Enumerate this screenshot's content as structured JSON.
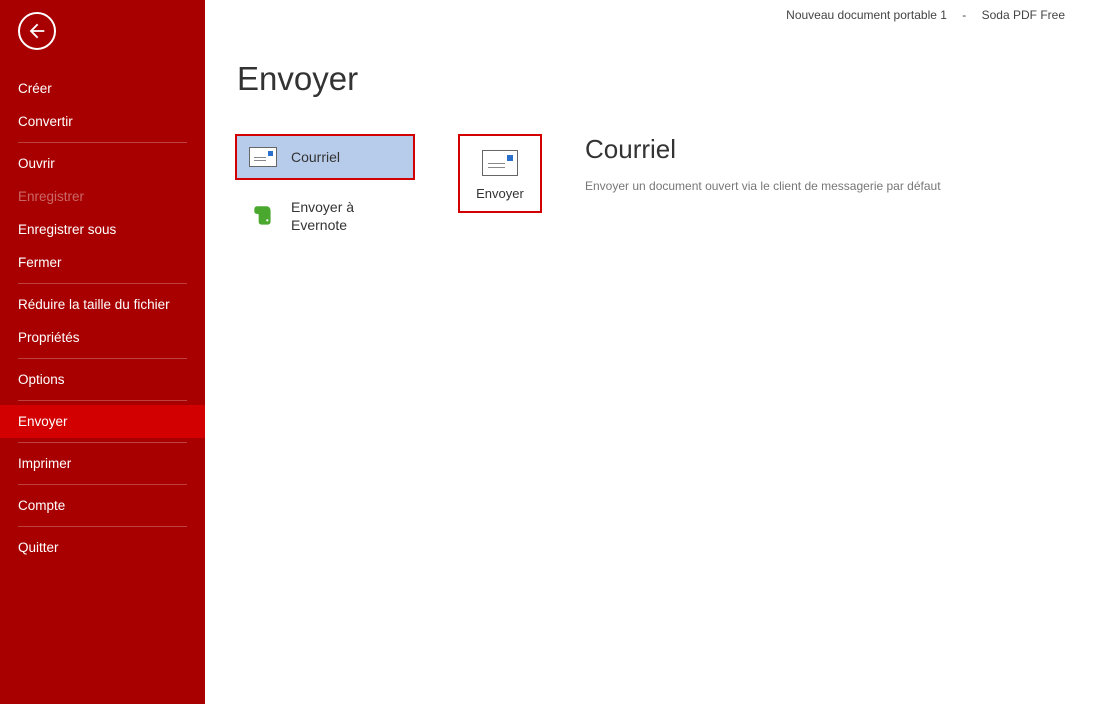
{
  "topbar": {
    "docname": "Nouveau document portable 1",
    "sep": "-",
    "appname": "Soda PDF Free"
  },
  "sidebar": {
    "creer": "Créer",
    "convertir": "Convertir",
    "ouvrir": "Ouvrir",
    "enregistrer": "Enregistrer",
    "enreg_sous": "Enregistrer sous",
    "fermer": "Fermer",
    "reduire": "Réduire la taille du fichier",
    "proprietes": "Propriétés",
    "options": "Options",
    "envoyer": "Envoyer",
    "imprimer": "Imprimer",
    "compte": "Compte",
    "quitter": "Quitter"
  },
  "page": {
    "title": "Envoyer"
  },
  "options": {
    "courriel": "Courriel",
    "evernote_l1": "Envoyer à",
    "evernote_l2": "Evernote"
  },
  "action": {
    "label": "Envoyer"
  },
  "detail": {
    "title": "Courriel",
    "desc": "Envoyer un document ouvert via le client de messagerie par défaut"
  }
}
